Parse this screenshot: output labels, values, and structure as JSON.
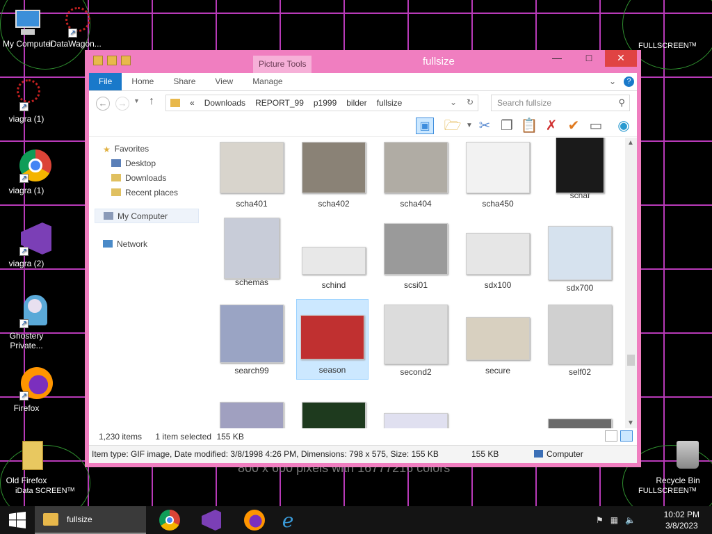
{
  "desktop": {
    "fullscreen_label": "FULLSCREENᵀᴹ",
    "data_fullscreen_label": "iData SCREENᵀᴹ",
    "background_text": "800 x 600 pixels with 16777216 colors",
    "icons": [
      {
        "label": "My Computer"
      },
      {
        "label": "iDataWagon..."
      },
      {
        "label": "viagra (1)"
      },
      {
        "label": "viagra (1)"
      },
      {
        "label": "viagra (2)"
      },
      {
        "label": "Ghostery Private..."
      },
      {
        "label": "Firefox"
      },
      {
        "label": "Old Firefox"
      },
      {
        "label": "Recycle Bin"
      }
    ]
  },
  "window": {
    "title": "fullsize",
    "context_tab": "Picture Tools",
    "ribbon_tabs": [
      "File",
      "Home",
      "Share",
      "View",
      "Manage"
    ],
    "address": {
      "prefix": "«",
      "crumbs": [
        "Downloads",
        "REPORT_99",
        "p1999",
        "bilder",
        "fullsize"
      ]
    },
    "search_placeholder": "Search fullsize",
    "nav": {
      "favorites": "Favorites",
      "desktop": "Desktop",
      "downloads": "Downloads",
      "recent": "Recent places",
      "computer": "My Computer",
      "network": "Network"
    },
    "files": [
      {
        "name": "scha401",
        "color": "#d8d4cc"
      },
      {
        "name": "scha402",
        "color": "#8a8276"
      },
      {
        "name": "scha404",
        "color": "#b0aca4"
      },
      {
        "name": "scha450",
        "color": "#f2f2f2"
      },
      {
        "name": "schaf",
        "color": "#1a1a1a"
      },
      {
        "name": "schemas",
        "color": "#c8ccd8"
      },
      {
        "name": "schind",
        "color": "#e8e8e8"
      },
      {
        "name": "scsi01",
        "color": "#9a9a9a"
      },
      {
        "name": "sdx100",
        "color": "#e6e6e6"
      },
      {
        "name": "sdx700",
        "color": "#d6e2ee"
      },
      {
        "name": "search99",
        "color": "#9aa4c4"
      },
      {
        "name": "season",
        "color": "#c03030"
      },
      {
        "name": "second2",
        "color": "#dcdcdc"
      },
      {
        "name": "secure",
        "color": "#d8d0c0"
      },
      {
        "name": "self02",
        "color": "#d0d0d0"
      }
    ],
    "status": {
      "count": "1,230 items",
      "selected": "1 item selected",
      "size": "155 KB"
    },
    "details": {
      "text": "Item type: GIF image, Date modified: 3/8/1998 4:26 PM, Dimensions: 798 x 575, Size: 155 KB",
      "size": "155 KB",
      "location": "Computer"
    }
  },
  "taskbar": {
    "active_label": "fullsize",
    "time": "10:02 PM",
    "date": "3/8/2023"
  }
}
